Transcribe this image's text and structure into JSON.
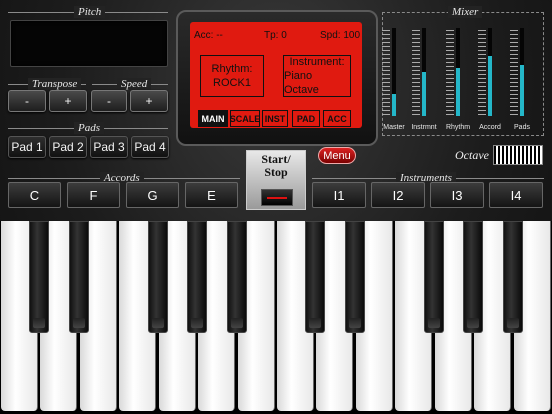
{
  "pitch": {
    "label": "Pitch"
  },
  "transpose": {
    "label": "Transpose",
    "minus": "-",
    "plus": "+"
  },
  "speed": {
    "label": "Speed",
    "minus": "-",
    "plus": "+"
  },
  "pads": {
    "label": "Pads",
    "items": [
      "Pad 1",
      "Pad 2",
      "Pad 3",
      "Pad 4"
    ]
  },
  "accords": {
    "label": "Accords",
    "items": [
      "C",
      "F",
      "G",
      "E"
    ]
  },
  "instruments": {
    "label": "Instruments",
    "items": [
      "I1",
      "I2",
      "I3",
      "I4"
    ]
  },
  "screen": {
    "acc": "Acc: --",
    "tp": "Tp: 0",
    "spd": "Spd: 100",
    "rhythm_title": "Rhythm:",
    "rhythm_value": "ROCK1",
    "instrument_title": "Instrument:",
    "instrument_value": "Piano Octave",
    "tabs": [
      "MAIN",
      "SCALE",
      "INST",
      "PAD",
      "ACC"
    ],
    "active_tab": "MAIN"
  },
  "mixer": {
    "label": "Mixer",
    "channels": [
      {
        "name": "Master",
        "level": 0.25
      },
      {
        "name": "Instrmnt",
        "level": 0.5
      },
      {
        "name": "Rhythm",
        "level": 0.55
      },
      {
        "name": "Accord",
        "level": 0.68
      },
      {
        "name": "Pads",
        "level": 0.58
      }
    ]
  },
  "menu": {
    "label": "Menu"
  },
  "start_stop": {
    "label": "Start/\nStop"
  },
  "octave": {
    "label": "Octave"
  },
  "colors": {
    "screen": "#e01a10",
    "mixer_fill": "#24b7c9",
    "menu": "#cc1111"
  }
}
